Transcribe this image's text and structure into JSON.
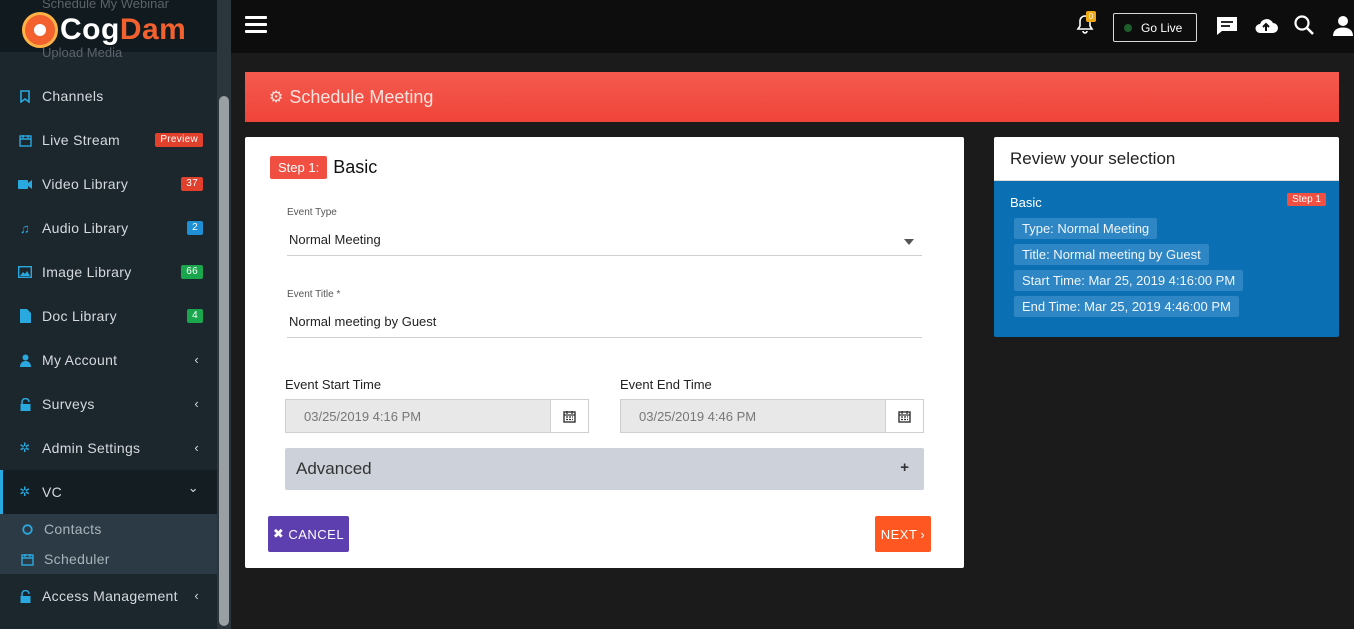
{
  "sidebar": {
    "hidden_top_item": "Schedule My Webinar",
    "hidden_upload_item": "Upload Media",
    "logo": {
      "part1": "Cog",
      "part2": "Dam"
    },
    "items": [
      {
        "label": "Channels",
        "icon": "bookmark-icon"
      },
      {
        "label": "Live Stream",
        "icon": "calendar-icon",
        "badge": "Preview",
        "badge_color": "#e0402c"
      },
      {
        "label": "Video Library",
        "icon": "video-icon",
        "badge": "37",
        "badge_color": "#e0402c"
      },
      {
        "label": "Audio Library",
        "icon": "music-icon",
        "badge": "2",
        "badge_color": "#1f8fd6"
      },
      {
        "label": "Image Library",
        "icon": "image-icon",
        "badge": "66",
        "badge_color": "#1aa64c"
      },
      {
        "label": "Doc Library",
        "icon": "file-icon",
        "badge": "4",
        "badge_color": "#1aa64c"
      },
      {
        "label": "My Account",
        "icon": "user-icon"
      },
      {
        "label": "Surveys",
        "icon": "lock-icon"
      },
      {
        "label": "Admin Settings",
        "icon": "cogs-icon"
      },
      {
        "label": "VC",
        "icon": "cogs-icon"
      },
      {
        "label": "Contacts",
        "icon": "circle-icon"
      },
      {
        "label": "Scheduler",
        "icon": "calendar-icon"
      },
      {
        "label": "Access Management",
        "icon": "lock-icon"
      }
    ]
  },
  "topbar": {
    "notification_count": "0",
    "go_live_label": "Go Live"
  },
  "page": {
    "title": "Schedule Meeting"
  },
  "form": {
    "step_badge": "Step 1:",
    "step_label": "Basic",
    "event_type_label": "Event Type",
    "event_type_value": "Normal Meeting",
    "event_title_label": "Event Title *",
    "event_title_value": "Normal meeting by Guest",
    "start_label": "Event Start Time",
    "start_value": "03/25/2019 4:16 PM",
    "end_label": "Event End Time",
    "end_value": "03/25/2019 4:46 PM",
    "advanced_label": "Advanced",
    "cancel_label": "CANCEL",
    "next_label": "NEXT"
  },
  "review": {
    "title": "Review your selection",
    "section": "Basic",
    "step": "Step 1",
    "chips": [
      "Type: Normal Meeting",
      "Title: Normal meeting by Guest",
      "Start Time: Mar 25, 2019 4:16:00 PM",
      "End Time: Mar 25, 2019 4:46:00 PM"
    ]
  }
}
